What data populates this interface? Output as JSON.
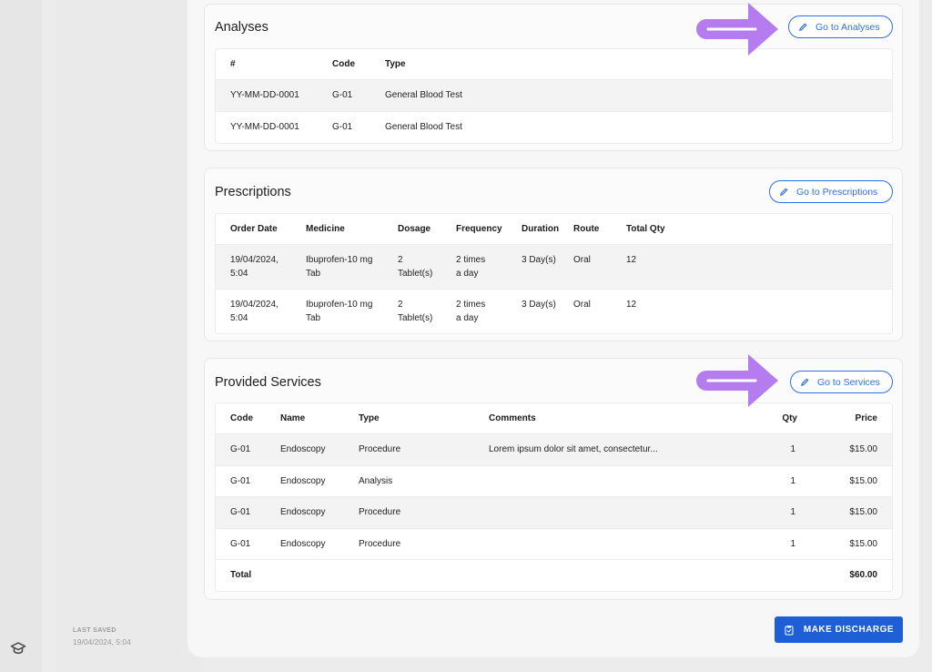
{
  "footer": {
    "last_saved_label": "LAST SAVED",
    "last_saved_value": "19/04/2024, 5:04",
    "discharge_label": "MAKE DISCHARGE"
  },
  "analyses": {
    "title": "Analyses",
    "button_label": "Go to Analyses",
    "headers": [
      "#",
      "Code",
      "Type"
    ],
    "rows": [
      [
        "YY-MM-DD-0001",
        "G-01",
        "General Blood Test"
      ],
      [
        "YY-MM-DD-0001",
        "G-01",
        "General Blood Test"
      ]
    ]
  },
  "prescriptions": {
    "title": "Prescriptions",
    "button_label": "Go to Prescriptions",
    "headers": [
      "Order Date",
      "Medicine",
      "Dosage",
      "Frequency",
      "Duration",
      "Route",
      "Total Qty"
    ],
    "rows": [
      [
        [
          "19/04/2024,",
          "5:04"
        ],
        [
          "Ibuprofen-10 mg",
          "Tab"
        ],
        [
          "2",
          "Tablet(s)"
        ],
        [
          "2 times",
          "a day"
        ],
        [
          "3 Day(s)"
        ],
        [
          "Oral"
        ],
        [
          "12"
        ]
      ],
      [
        [
          "19/04/2024,",
          "5:04"
        ],
        [
          "Ibuprofen-10 mg",
          "Tab"
        ],
        [
          "2",
          "Tablet(s)"
        ],
        [
          "2 times",
          "a day"
        ],
        [
          "3 Day(s)"
        ],
        [
          "Oral"
        ],
        [
          "12"
        ]
      ]
    ]
  },
  "services": {
    "title": "Provided Services",
    "button_label": "Go to Services",
    "headers": [
      "Code",
      "Name",
      "Type",
      "Comments",
      "Qty",
      "Price"
    ],
    "rows": [
      [
        "G-01",
        "Endoscopy",
        "Procedure",
        "Lorem ipsum dolor sit amet, consectetur...",
        "1",
        "$15.00"
      ],
      [
        "G-01",
        "Endoscopy",
        "Analysis",
        "",
        "1",
        "$15.00"
      ],
      [
        "G-01",
        "Endoscopy",
        "Procedure",
        "",
        "1",
        "$15.00"
      ],
      [
        "G-01",
        "Endoscopy",
        "Procedure",
        "",
        "1",
        "$15.00"
      ]
    ],
    "total_label": "Total",
    "total_value": "$60.00"
  },
  "icons": {
    "rail_icon": "graduation-cap-icon",
    "edit_icon": "pencil-icon",
    "discharge_icon": "clipboard-check-icon",
    "annotation": "purple-arrow-icon"
  },
  "colors": {
    "accent": "#2f6fe0",
    "primary_button": "#1f5fd6",
    "annotation_arrow": "#b57cf0"
  }
}
